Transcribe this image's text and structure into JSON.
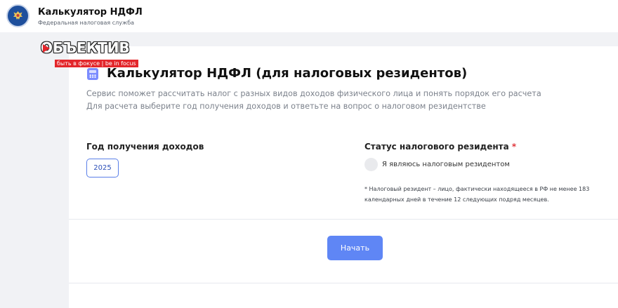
{
  "header": {
    "title": "Калькулятор НДФЛ",
    "subtitle": "Федеральная налоговая служба",
    "logo_icon": "eagle-emblem-icon"
  },
  "watermark": {
    "logo_text": "ОБЪЕКТИВ",
    "tagline": "быть в фокусе | be in focus",
    "accent_color": "#e3262b"
  },
  "main": {
    "title_icon": "calculator-icon",
    "title": "Калькулятор НДФЛ (для налоговых резидентов)",
    "description_line1": "Сервис поможет рассчитать налог с разных видов доходов физического лица и понять порядок его расчета",
    "description_line2": "Для расчета выберите год получения доходов и ответьте на вопрос о налоговом резидентстве"
  },
  "form": {
    "year_label": "Год получения доходов",
    "year_value": "2025",
    "status_label": "Статус налогового резидента",
    "required_mark": "*",
    "radio_label": "Я являюсь налоговым резидентом",
    "radio_checked": false,
    "note_line1": "* Налоговый резидент – лицо, фактически находящееся в РФ не менее 183",
    "note_line2": "календарных дней в течение 12 следующих подряд месяцев."
  },
  "actions": {
    "start_label": "Начать",
    "start_color": "#5f86f5"
  }
}
